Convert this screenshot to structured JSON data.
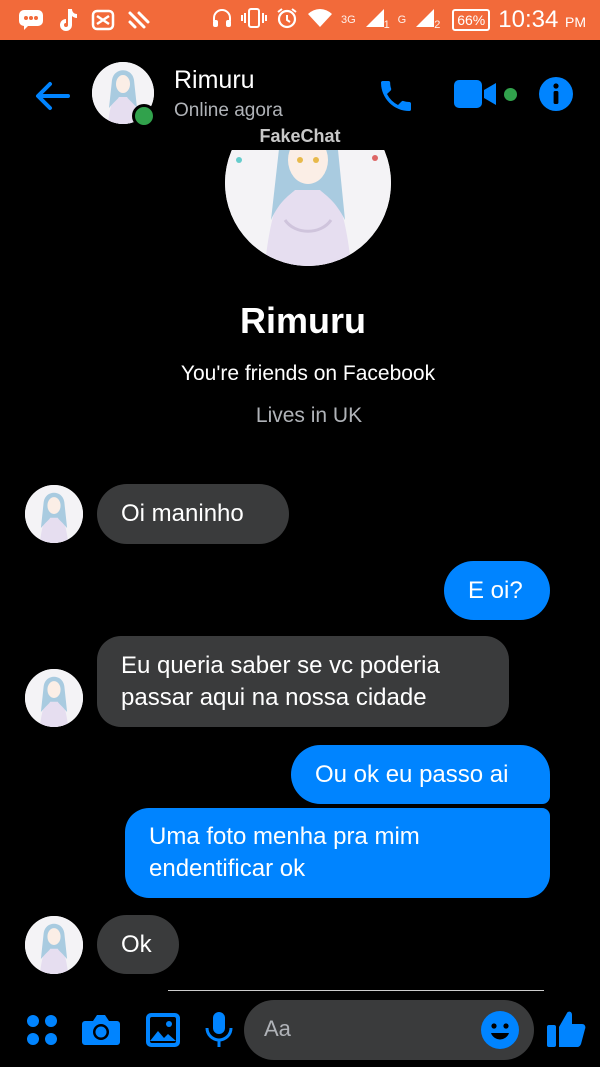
{
  "status_bar": {
    "network_3g": "3G",
    "network_g": "G",
    "sim1": "1",
    "sim2": "2",
    "battery": "66%",
    "time": "10:34",
    "ampm": "PM"
  },
  "header": {
    "name": "Rimuru",
    "status": "Online agora"
  },
  "watermark": "FakeChat",
  "profile": {
    "name": "Rimuru",
    "friends_text": "You're friends on Facebook",
    "lives_text": "Lives in UK"
  },
  "messages": [
    {
      "from": "them",
      "text": "Oi maninho"
    },
    {
      "from": "me",
      "text": "E oi?"
    },
    {
      "from": "them",
      "text": "Eu queria saber se vc poderia passar aqui na nossa cidade"
    },
    {
      "from": "me",
      "text": "Ou ok eu passo ai"
    },
    {
      "from": "me",
      "text": "Uma foto menha pra mim endentificar ok"
    },
    {
      "from": "them",
      "text": "Ok"
    }
  ],
  "composer": {
    "placeholder": "Aa"
  },
  "colors": {
    "status_bar": "#f26a3a",
    "accent": "#0084ff",
    "incoming_bubble": "#3a3b3c",
    "online": "#31a24c"
  },
  "icons": [
    "back-arrow-icon",
    "phone-icon",
    "video-icon",
    "info-icon",
    "apps-icon",
    "camera-icon",
    "gallery-icon",
    "microphone-icon",
    "emoji-icon",
    "thumbs-up-icon"
  ]
}
